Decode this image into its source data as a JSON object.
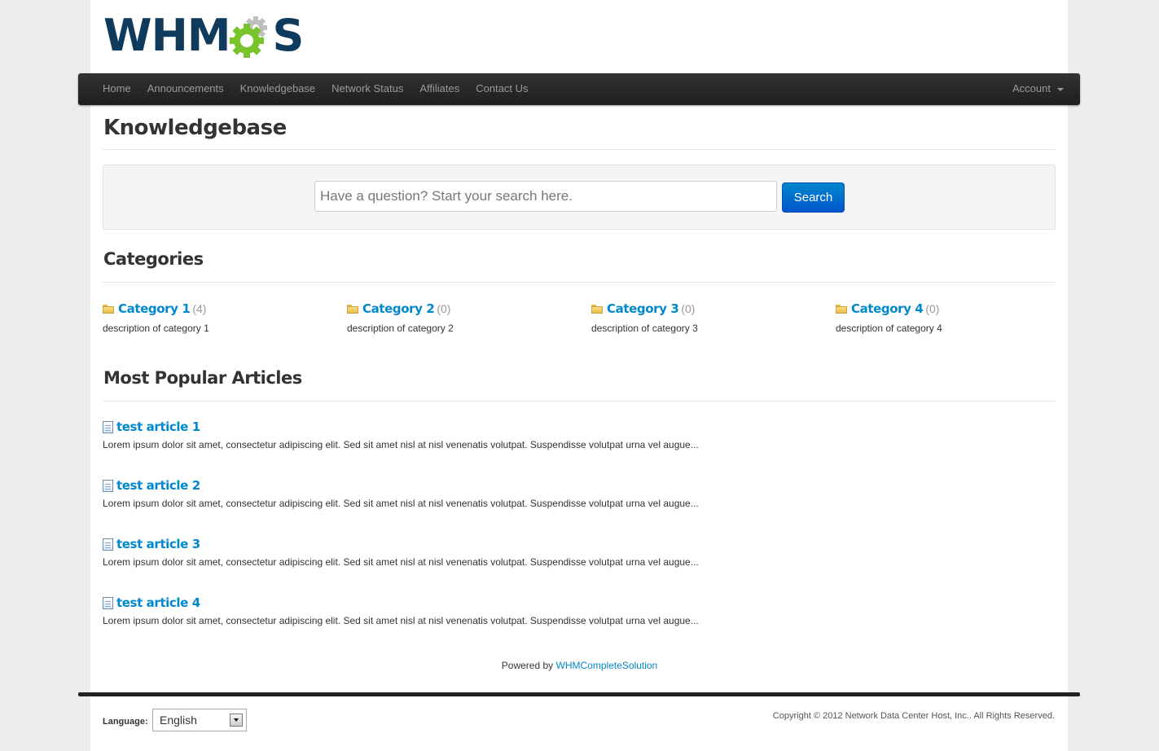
{
  "logo": {
    "text_before": "WHM",
    "text_after": "S",
    "gear_colors": [
      "#79c42a",
      "#bfbfbf"
    ]
  },
  "nav": {
    "items": [
      "Home",
      "Announcements",
      "Knowledgebase",
      "Network Status",
      "Affiliates",
      "Contact Us"
    ],
    "account": "Account"
  },
  "page_title": "Knowledgebase",
  "search": {
    "placeholder": "Have a question? Start your search here.",
    "button": "Search"
  },
  "categories": {
    "heading": "Categories",
    "items": [
      {
        "name": "Category 1",
        "count": "(4)",
        "description": "description of category 1"
      },
      {
        "name": "Category 2",
        "count": "(0)",
        "description": "description of category 2"
      },
      {
        "name": "Category 3",
        "count": "(0)",
        "description": "description of category 3"
      },
      {
        "name": "Category 4",
        "count": "(0)",
        "description": "description of category 4"
      }
    ]
  },
  "articles": {
    "heading": "Most Popular Articles",
    "items": [
      {
        "title": "test article 1",
        "excerpt": "Lorem ipsum dolor sit amet, consectetur adipiscing elit. Sed sit amet nisl at nisl venenatis volutpat. Suspendisse volutpat urna vel augue..."
      },
      {
        "title": "test article 2",
        "excerpt": "Lorem ipsum dolor sit amet, consectetur adipiscing elit. Sed sit amet nisl at nisl venenatis volutpat. Suspendisse volutpat urna vel augue..."
      },
      {
        "title": "test article 3",
        "excerpt": "Lorem ipsum dolor sit amet, consectetur adipiscing elit. Sed sit amet nisl at nisl venenatis volutpat. Suspendisse volutpat urna vel augue..."
      },
      {
        "title": "test article 4",
        "excerpt": "Lorem ipsum dolor sit amet, consectetur adipiscing elit. Sed sit amet nisl at nisl venenatis volutpat. Suspendisse volutpat urna vel augue..."
      }
    ]
  },
  "footer": {
    "powered_prefix": "Powered by",
    "powered_link": "WHMCompleteSolution",
    "language_label": "Language:",
    "language_value": "English",
    "copyright": "Copyright © 2012 Network Data Center Host, Inc.. All Rights Reserved."
  },
  "colors": {
    "link": "#0088cc",
    "logo_blue": "#0f3a5b",
    "navbar": "#222222",
    "button": "#0066cc"
  }
}
